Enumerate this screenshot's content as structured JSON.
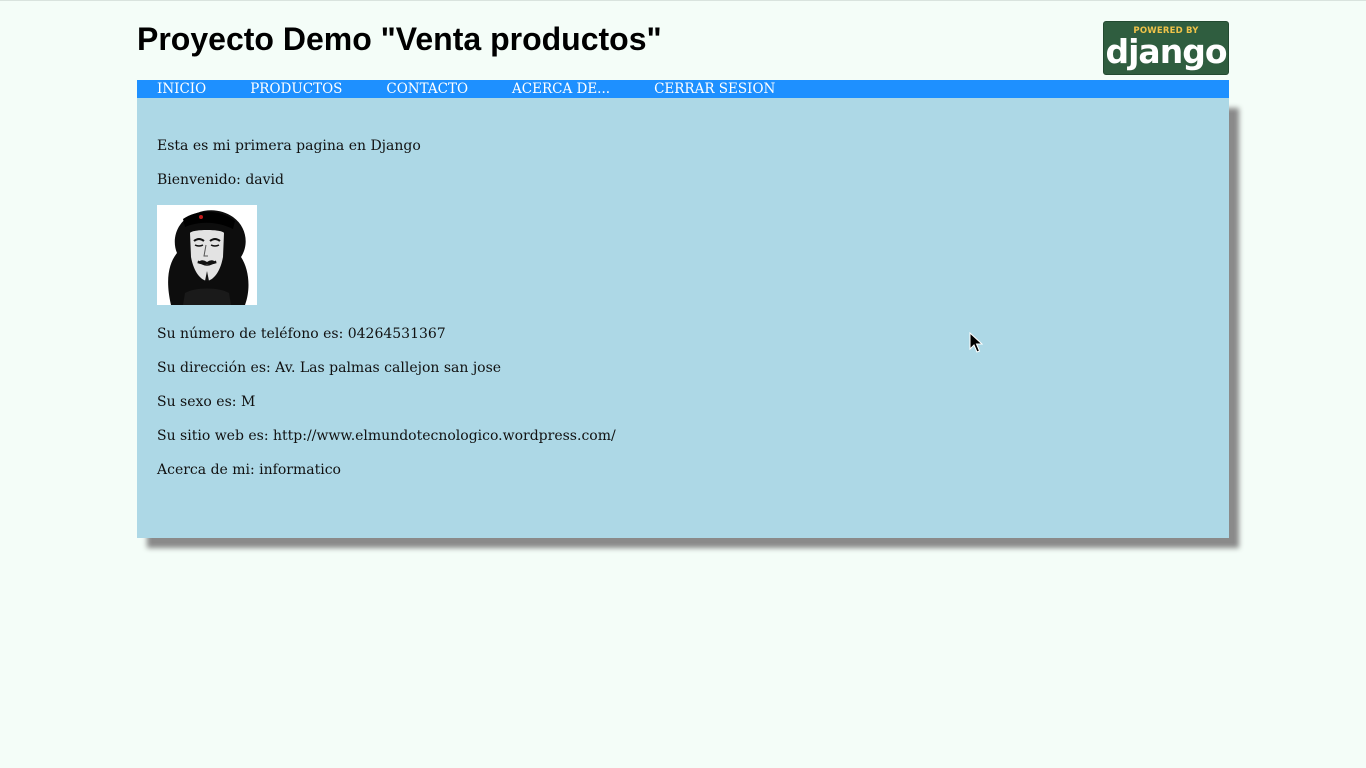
{
  "header": {
    "title": "Proyecto Demo \"Venta productos\"",
    "badge": {
      "top_text": "POWERED BY",
      "word": "django"
    }
  },
  "nav": {
    "items": [
      {
        "label": "INICIO"
      },
      {
        "label": "PRODUCTOS"
      },
      {
        "label": "CONTACTO"
      },
      {
        "label": "ACERCA DE..."
      },
      {
        "label": "CERRAR SESION"
      }
    ]
  },
  "content": {
    "intro": "Esta es mi primera pagina en Django",
    "welcome": "Bienvenido: david",
    "avatar_icon": "guy-fawkes-mask-avatar",
    "phone": "Su número de teléfono es: 04264531367",
    "address": "Su dirección es: Av. Las palmas callejon san jose",
    "sex": "Su sexo es: M",
    "website": "Su sitio web es: http://www.elmundotecnologico.wordpress.com/",
    "about": "Acerca de mi: informatico"
  },
  "colors": {
    "page_bg": "#f4fdf8",
    "nav_bg": "#1e90ff",
    "content_bg": "#add8e6",
    "badge_bg": "#2f5d3f",
    "badge_accent": "#f0c34a"
  }
}
